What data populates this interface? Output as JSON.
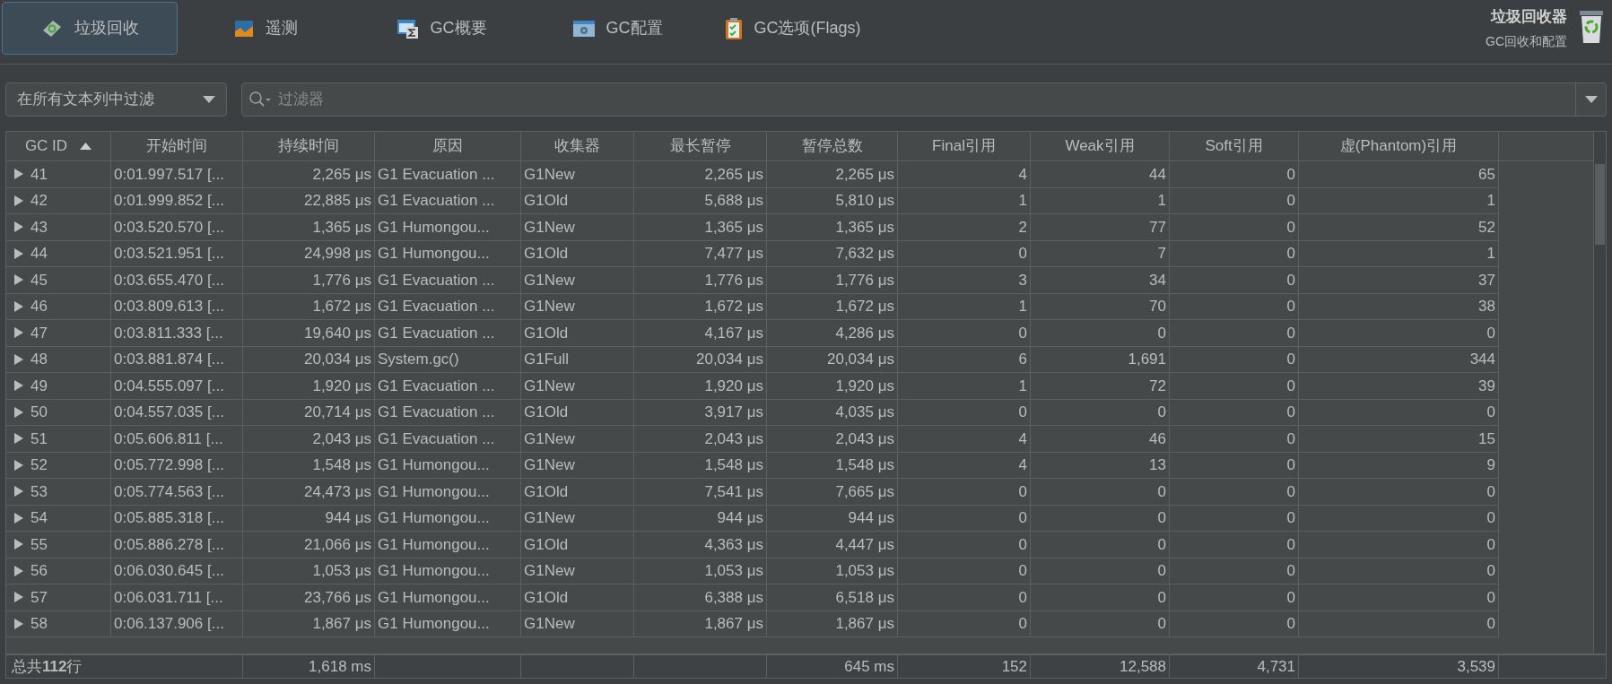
{
  "tabs": [
    {
      "label": "垃圾回收",
      "selected": true
    },
    {
      "label": "遥测",
      "selected": false
    },
    {
      "label": "GC概要",
      "selected": false
    },
    {
      "label": "GC配置",
      "selected": false
    },
    {
      "label": "GC选项(Flags)",
      "selected": false
    }
  ],
  "header": {
    "title": "垃圾回收器",
    "subtitle": "GC回收和配置"
  },
  "filter": {
    "scope": "在所有文本列中过滤",
    "placeholder": "过滤器"
  },
  "table": {
    "columns": [
      {
        "label": "GC ID",
        "kind": "id",
        "sorted": true
      },
      {
        "label": "开始时间",
        "kind": "text",
        "sorted": false
      },
      {
        "label": "持续时间",
        "kind": "number",
        "sorted": false
      },
      {
        "label": "原因",
        "kind": "text",
        "sorted": false
      },
      {
        "label": "收集器",
        "kind": "text",
        "sorted": false
      },
      {
        "label": "最长暂停",
        "kind": "number",
        "sorted": false
      },
      {
        "label": "暂停总数",
        "kind": "number",
        "sorted": false
      },
      {
        "label": "Final引用",
        "kind": "number",
        "sorted": false
      },
      {
        "label": "Weak引用",
        "kind": "number",
        "sorted": false
      },
      {
        "label": "Soft引用",
        "kind": "number",
        "sorted": false
      },
      {
        "label": "虚(Phantom)引用",
        "kind": "number",
        "sorted": false
      }
    ],
    "rows": [
      {
        "expanded": false,
        "cells": [
          "41",
          "0:01.997.517 [...",
          "2,265 μs",
          "G1 Evacuation ...",
          "G1New",
          "2,265 μs",
          "2,265 μs",
          "4",
          "44",
          "0",
          "65"
        ]
      },
      {
        "expanded": false,
        "cells": [
          "42",
          "0:01.999.852 [...",
          "22,885 μs",
          "G1 Evacuation ...",
          "G1Old",
          "5,688 μs",
          "5,810 μs",
          "1",
          "1",
          "0",
          "1"
        ]
      },
      {
        "expanded": false,
        "cells": [
          "43",
          "0:03.520.570 [...",
          "1,365 μs",
          "G1 Humongou...",
          "G1New",
          "1,365 μs",
          "1,365 μs",
          "2",
          "77",
          "0",
          "52"
        ]
      },
      {
        "expanded": false,
        "cells": [
          "44",
          "0:03.521.951 [...",
          "24,998 μs",
          "G1 Humongou...",
          "G1Old",
          "7,477 μs",
          "7,632 μs",
          "0",
          "7",
          "0",
          "1"
        ]
      },
      {
        "expanded": false,
        "cells": [
          "45",
          "0:03.655.470 [...",
          "1,776 μs",
          "G1 Evacuation ...",
          "G1New",
          "1,776 μs",
          "1,776 μs",
          "3",
          "34",
          "0",
          "37"
        ]
      },
      {
        "expanded": false,
        "cells": [
          "46",
          "0:03.809.613 [...",
          "1,672 μs",
          "G1 Evacuation ...",
          "G1New",
          "1,672 μs",
          "1,672 μs",
          "1",
          "70",
          "0",
          "38"
        ]
      },
      {
        "expanded": false,
        "cells": [
          "47",
          "0:03.811.333 [...",
          "19,640 μs",
          "G1 Evacuation ...",
          "G1Old",
          "4,167 μs",
          "4,286 μs",
          "0",
          "0",
          "0",
          "0"
        ]
      },
      {
        "expanded": false,
        "cells": [
          "48",
          "0:03.881.874 [...",
          "20,034 μs",
          "System.gc()",
          "G1Full",
          "20,034 μs",
          "20,034 μs",
          "6",
          "1,691",
          "0",
          "344"
        ]
      },
      {
        "expanded": false,
        "cells": [
          "49",
          "0:04.555.097 [...",
          "1,920 μs",
          "G1 Evacuation ...",
          "G1New",
          "1,920 μs",
          "1,920 μs",
          "1",
          "72",
          "0",
          "39"
        ]
      },
      {
        "expanded": false,
        "cells": [
          "50",
          "0:04.557.035 [...",
          "20,714 μs",
          "G1 Evacuation ...",
          "G1Old",
          "3,917 μs",
          "4,035 μs",
          "0",
          "0",
          "0",
          "0"
        ]
      },
      {
        "expanded": false,
        "cells": [
          "51",
          "0:05.606.811 [...",
          "2,043 μs",
          "G1 Evacuation ...",
          "G1New",
          "2,043 μs",
          "2,043 μs",
          "4",
          "46",
          "0",
          "15"
        ]
      },
      {
        "expanded": false,
        "cells": [
          "52",
          "0:05.772.998 [...",
          "1,548 μs",
          "G1 Humongou...",
          "G1New",
          "1,548 μs",
          "1,548 μs",
          "4",
          "13",
          "0",
          "9"
        ]
      },
      {
        "expanded": false,
        "cells": [
          "53",
          "0:05.774.563 [...",
          "24,473 μs",
          "G1 Humongou...",
          "G1Old",
          "7,541 μs",
          "7,665 μs",
          "0",
          "0",
          "0",
          "0"
        ]
      },
      {
        "expanded": false,
        "cells": [
          "54",
          "0:05.885.318 [...",
          "944 μs",
          "G1 Humongou...",
          "G1New",
          "944 μs",
          "944 μs",
          "0",
          "0",
          "0",
          "0"
        ]
      },
      {
        "expanded": false,
        "cells": [
          "55",
          "0:05.886.278 [...",
          "21,066 μs",
          "G1 Humongou...",
          "G1Old",
          "4,363 μs",
          "4,447 μs",
          "0",
          "0",
          "0",
          "0"
        ]
      },
      {
        "expanded": false,
        "cells": [
          "56",
          "0:06.030.645 [...",
          "1,053 μs",
          "G1 Humongou...",
          "G1New",
          "1,053 μs",
          "1,053 μs",
          "0",
          "0",
          "0",
          "0"
        ]
      },
      {
        "expanded": false,
        "cells": [
          "57",
          "0:06.031.711 [...",
          "23,766 μs",
          "G1 Humongou...",
          "G1Old",
          "6,388 μs",
          "6,518 μs",
          "0",
          "0",
          "0",
          "0"
        ]
      },
      {
        "expanded": false,
        "cells": [
          "58",
          "0:06.137.906 [...",
          "1,867 μs",
          "G1 Humongou...",
          "G1New",
          "1,867 μs",
          "1,867 μs",
          "0",
          "0",
          "0",
          "0"
        ]
      }
    ],
    "totals": {
      "label": "总共**112**行",
      "duration": "1,618 ms",
      "pause_total": "645 ms",
      "final": "152",
      "weak": "12,588",
      "soft": "4,731",
      "phantom": "3,539"
    }
  }
}
